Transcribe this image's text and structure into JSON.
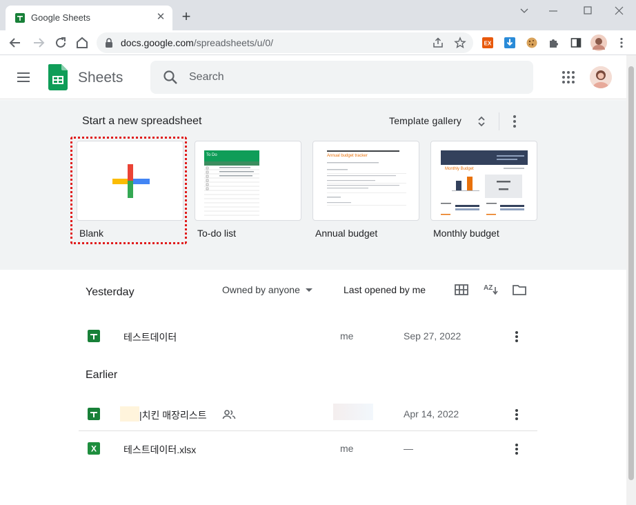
{
  "browser": {
    "tab_title": "Google Sheets",
    "url_host": "docs.google.com",
    "url_path": "/spreadsheets/u/0/"
  },
  "header": {
    "app_name": "Sheets",
    "search_placeholder": "Search"
  },
  "templates": {
    "heading": "Start a new spreadsheet",
    "gallery_label": "Template gallery",
    "cards": [
      {
        "label": "Blank"
      },
      {
        "label": "To-do list"
      },
      {
        "label": "Annual budget"
      },
      {
        "label": "Monthly budget"
      }
    ],
    "todo_title": "To Do",
    "annual_title": "Annual budget tracker",
    "monthly_title": "Monthly Budget"
  },
  "files": {
    "filter_label": "Owned by anyone",
    "sort_label": "Last opened by me",
    "sort_az_label": "AZ",
    "sections": [
      {
        "title": "Yesterday",
        "rows": [
          {
            "name": "테스트데이터",
            "owner": "me",
            "date": "Sep 27, 2022",
            "type": "sheet"
          }
        ]
      },
      {
        "title": "Earlier",
        "rows": [
          {
            "name": "|치킨 매장리스트",
            "owner": "",
            "date": "Apr 14, 2022",
            "type": "sheet",
            "shared": true
          },
          {
            "name": "테스트데이터.xlsx",
            "owner": "me",
            "date": "—",
            "type": "excel"
          }
        ]
      }
    ]
  },
  "colors": {
    "sheets_green": "#188038",
    "excel_green": "#1e8e3e",
    "highlight": "#e01b1b",
    "template_bg": "#f1f3f4"
  }
}
